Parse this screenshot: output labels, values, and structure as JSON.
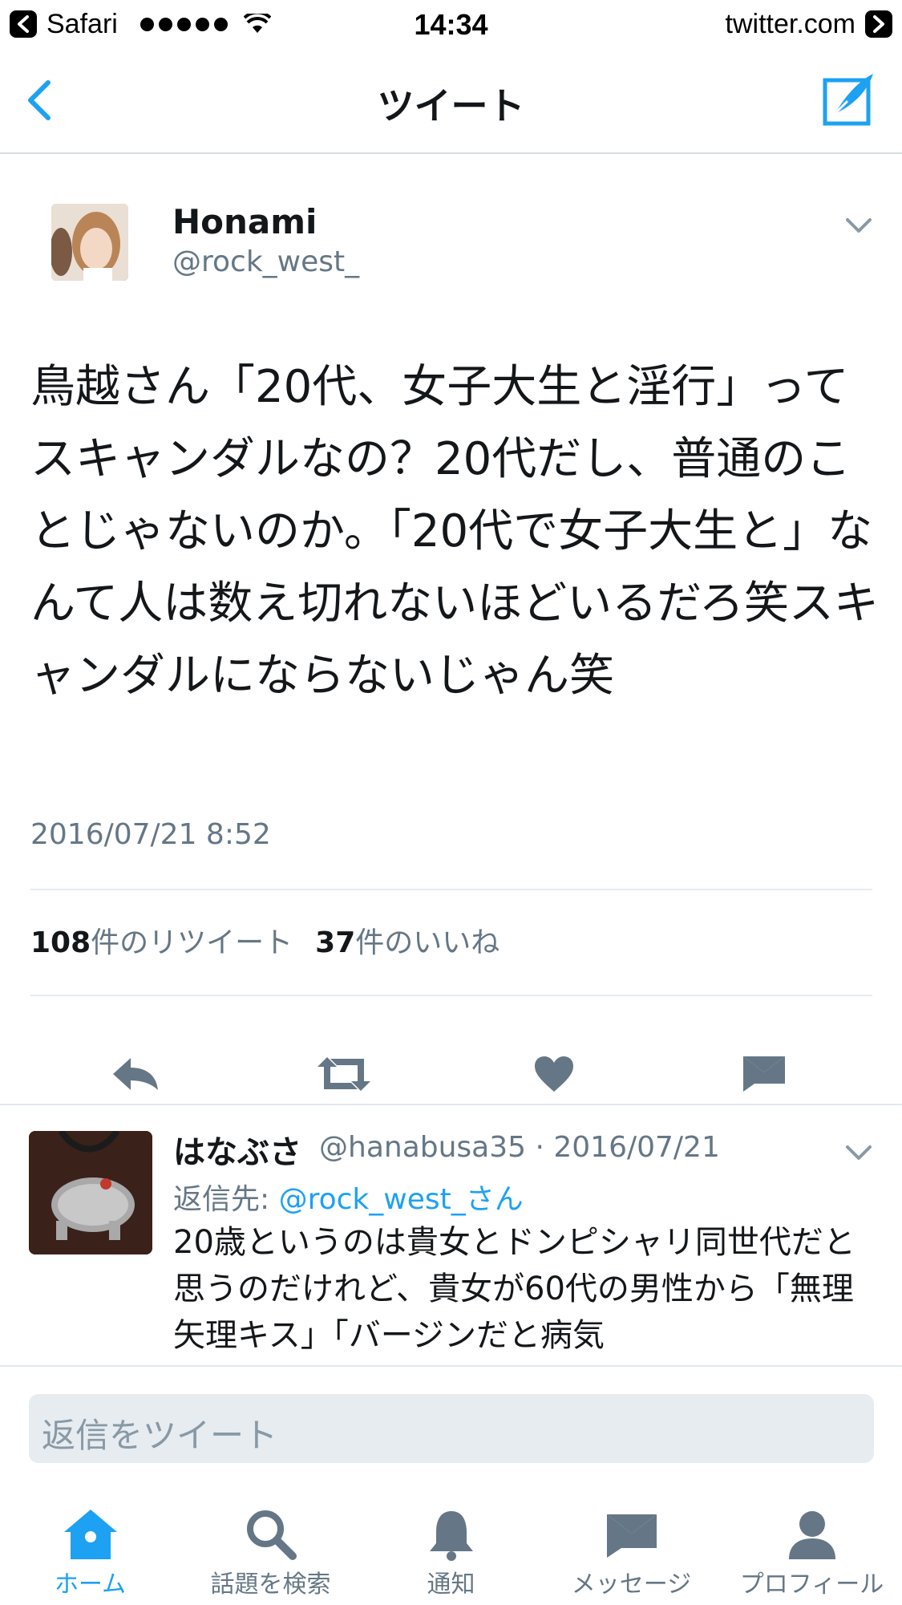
{
  "status_bar": {
    "app": "Safari",
    "time": "14:34",
    "url": "twitter.com"
  },
  "nav": {
    "title": "ツイート"
  },
  "tweet": {
    "name": "Honami",
    "handle": "@rock_west_",
    "text": "鳥越さん「20代、女子大生と淫行」ってスキャンダルなの？20代だし、普通のことじゃないのか。「20代で女子大生と」なんて人は数え切れないほどいるだろ笑スキャンダルにならないじゃん笑",
    "date": "2016/07/21 8:52",
    "retweet_count": "108",
    "retweet_label": "件のリツイート",
    "like_count": "37",
    "like_label": "件のいいね"
  },
  "reply": {
    "name": "はなぶさ",
    "meta": "@hanabusa35 · 2016/07/21",
    "reply_to_prefix": "返信先: ",
    "reply_to_link": "@rock_west_さん",
    "text": "20歳というのは貴女とドンピシャリ同世代だと思うのだけれど、貴女が60代の男性から「無理矢理キス」「バージンだと病気"
  },
  "compose": {
    "placeholder": "返信をツイート"
  },
  "tabs": [
    {
      "label": "ホーム",
      "icon": "home-icon",
      "active": true
    },
    {
      "label": "話題を検索",
      "icon": "search-icon",
      "active": false
    },
    {
      "label": "通知",
      "icon": "bell-icon",
      "active": false
    },
    {
      "label": "メッセージ",
      "icon": "envelope-icon",
      "active": false
    },
    {
      "label": "プロフィール",
      "icon": "person-icon",
      "active": false
    }
  ],
  "colors": {
    "accent": "#1da1f2",
    "icon_gray": "#657786",
    "text": "#14171a"
  }
}
